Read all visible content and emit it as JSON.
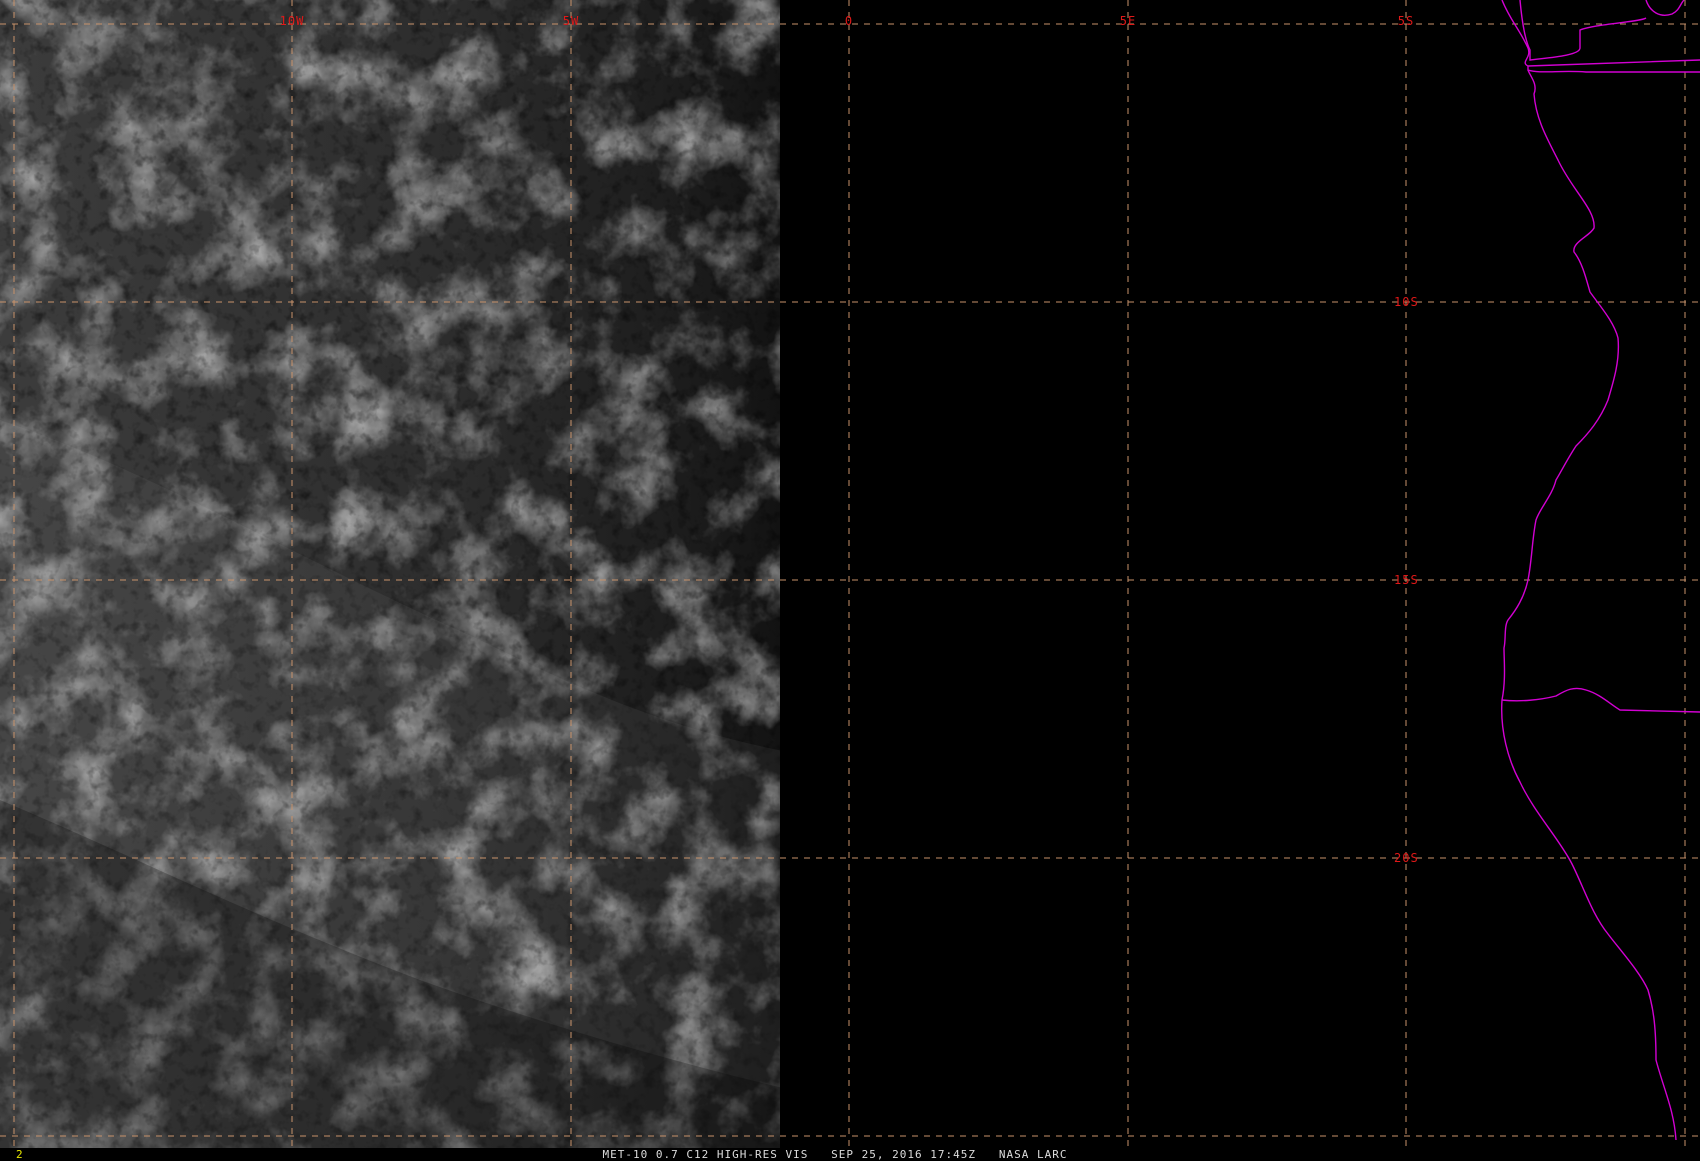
{
  "colors": {
    "grid": "#c8926a",
    "grid_label": "#e01818",
    "coastline": "#d200d2",
    "caption": "#dcdcdc",
    "frame_number": "#e8e800",
    "background": "#000000"
  },
  "map": {
    "longitude_labels": [
      "10W",
      "5W",
      "0",
      "5E",
      "5S"
    ],
    "latitude_labels": [
      "10S",
      "15S",
      "20S"
    ]
  },
  "status": {
    "frame_number": "2",
    "caption": "MET-10 0.7 C12 HIGH-RES VIS   SEP 25, 2016 17:45Z   NASA LARC"
  }
}
